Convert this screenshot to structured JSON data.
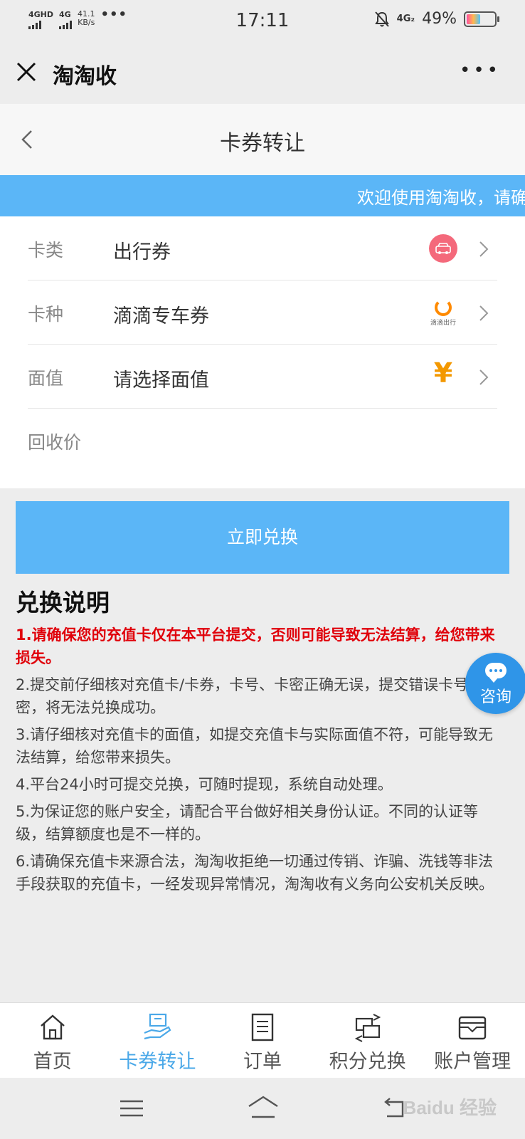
{
  "status_bar": {
    "network1": "4GHD",
    "network2": "4G",
    "speed_value": "41.1",
    "speed_unit": "KB/s",
    "more": "•••",
    "time": "17:11",
    "net_right": "4G₂",
    "battery": "49%",
    "battery_level": 0.49
  },
  "app_bar": {
    "title": "淘淘收",
    "more": "•••"
  },
  "page": {
    "title": "卡券转让",
    "marquee": "欢迎使用淘淘收，请确"
  },
  "form": {
    "rows": [
      {
        "label": "卡类",
        "value": "出行券",
        "icon": "car-icon"
      },
      {
        "label": "卡种",
        "value": "滴滴专车券",
        "icon": "didi-logo-icon",
        "icon_text": "滴滴出行"
      },
      {
        "label": "面值",
        "value": "请选择面值",
        "icon": "yen-icon",
        "icon_text": "¥"
      },
      {
        "label": "回收价",
        "value": ""
      }
    ]
  },
  "submit_label": "立即兑换",
  "notes": {
    "title": "兑换说明",
    "items": [
      "1.请确保您的充值卡仅在本平台提交，否则可能导致无法结算，给您带来损失。",
      "2.提交前仔细核对充值卡/卡券，卡号、卡密正确无误，提交错误卡号、卡密，将无法兑换成功。",
      "3.请仔细核对充值卡的面值，如提交充值卡与实际面值不符，可能导致无法结算，给您带来损失。",
      "4.平台24小时可提交兑换，可随时提现，系统自动处理。",
      "5.为保证您的账户安全，请配合平台做好相关身份认证。不同的认证等级，结算额度也是不一样的。",
      "6.请确保充值卡来源合法，淘淘收拒绝一切通过传销、诈骗、洗钱等非法手段获取的充值卡，一经发现异常情况，淘淘收有义务向公安机关反映。"
    ]
  },
  "consult_label": "咨询",
  "tabs": [
    {
      "label": "首页",
      "icon": "home-icon",
      "active": false
    },
    {
      "label": "卡券转让",
      "icon": "card-transfer-icon",
      "active": true
    },
    {
      "label": "订单",
      "icon": "order-icon",
      "active": false
    },
    {
      "label": "积分兑换",
      "icon": "points-exchange-icon",
      "active": false
    },
    {
      "label": "账户管理",
      "icon": "wallet-icon",
      "active": false
    }
  ],
  "watermark": "Baidu 经验",
  "colors": {
    "accent": "#5bb6f7",
    "tab_active": "#4aa8e8",
    "warning": "#e0000a",
    "consult": "#2f95e8"
  }
}
